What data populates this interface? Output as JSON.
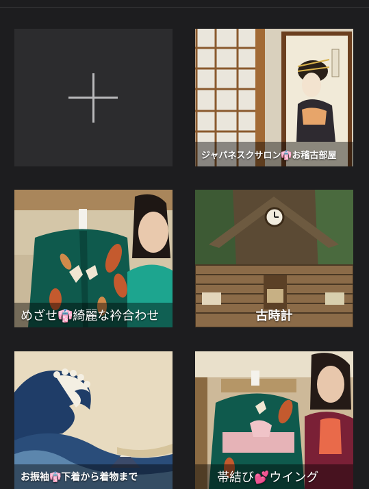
{
  "add_tile": {
    "icon": "plus-icon"
  },
  "tiles": [
    {
      "id": "japanese-salon",
      "title": "ジャパネスクサロン👘お稽古部屋"
    },
    {
      "id": "mezase",
      "title": "めざせ👘綺麗な衿合わせ"
    },
    {
      "id": "old-clock",
      "title": "古時計"
    },
    {
      "id": "furisode",
      "title": "お振袖👘下着から着物まで"
    },
    {
      "id": "obi",
      "title": "帯結び💕ウイング"
    }
  ]
}
